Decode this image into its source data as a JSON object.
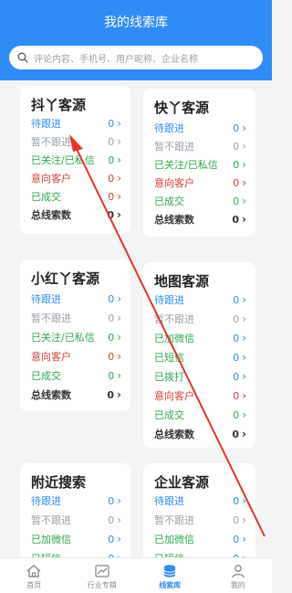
{
  "header": {
    "title": "我的线索库"
  },
  "search": {
    "placeholder": "评论内容、手机号、用户昵称、企业名称"
  },
  "cards": [
    {
      "title": "抖丫客源",
      "rows": [
        {
          "label": "待跟进",
          "value": "0"
        },
        {
          "label": "暂不跟进",
          "value": "0"
        },
        {
          "label": "已关注/已私信",
          "value": "0"
        },
        {
          "label": "意向客户",
          "value": "0"
        },
        {
          "label": "已成交",
          "value": "0"
        },
        {
          "label": "总线索数",
          "value": "0"
        }
      ]
    },
    {
      "title": "快丫客源",
      "rows": [
        {
          "label": "待跟进",
          "value": "0"
        },
        {
          "label": "暂不跟进",
          "value": "0"
        },
        {
          "label": "已关注/已私信",
          "value": "0"
        },
        {
          "label": "意向客户",
          "value": "0"
        },
        {
          "label": "已成交",
          "value": "0"
        },
        {
          "label": "总线索数",
          "value": "0"
        }
      ]
    },
    {
      "title": "小红丫客源",
      "rows": [
        {
          "label": "待跟进",
          "value": "0"
        },
        {
          "label": "暂不跟进",
          "value": "0"
        },
        {
          "label": "已关注/已私信",
          "value": "0"
        },
        {
          "label": "意向客户",
          "value": "0"
        },
        {
          "label": "已成交",
          "value": "0"
        },
        {
          "label": "总线索数",
          "value": "0"
        }
      ]
    },
    {
      "title": "地图客源",
      "rows": [
        {
          "label": "待跟进",
          "value": "0"
        },
        {
          "label": "暂不跟进",
          "value": "0"
        },
        {
          "label": "已加微信",
          "value": "0"
        },
        {
          "label": "已短信",
          "value": "0"
        },
        {
          "label": "已拨打",
          "value": "0"
        },
        {
          "label": "意向客户",
          "value": "0"
        },
        {
          "label": "已成交",
          "value": "0"
        },
        {
          "label": "总线索数",
          "value": "0"
        }
      ]
    },
    {
      "title": "附近搜索",
      "rows": [
        {
          "label": "待跟进",
          "value": "0"
        },
        {
          "label": "暂不跟进",
          "value": "0"
        },
        {
          "label": "已加微信",
          "value": "0"
        },
        {
          "label": "已短信",
          "value": "0"
        }
      ]
    },
    {
      "title": "企业客源",
      "rows": [
        {
          "label": "待跟进",
          "value": "0"
        },
        {
          "label": "暂不跟进",
          "value": "0"
        },
        {
          "label": "已加微信",
          "value": "0"
        },
        {
          "label": "已短信",
          "value": "0"
        }
      ]
    }
  ],
  "tabbar": {
    "home": "首页",
    "industry": "行业专辑",
    "leads": "线索库",
    "mine": "我的"
  },
  "colors": {
    "accent": "#2f8cf5",
    "annotation_arrow": "#e8322a"
  }
}
